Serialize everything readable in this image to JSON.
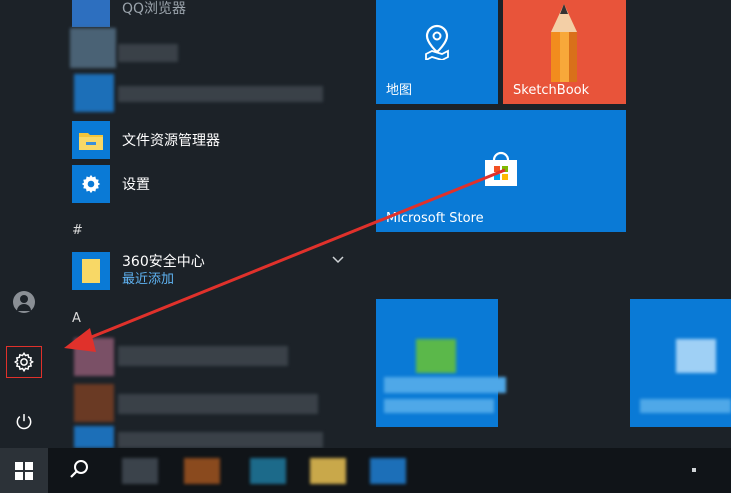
{
  "apps": {
    "top_partial": "QQ浏览器",
    "file_explorer": "文件资源管理器",
    "settings": "设置",
    "section_hash": "#",
    "security_center": "360安全中心",
    "security_center_sub": "最近添加",
    "section_a": "A"
  },
  "tiles": {
    "maps": "地图",
    "sketchbook": "SketchBook",
    "store": "Microsoft Store"
  },
  "colors": {
    "accent": "#0a7ad6",
    "background": "#1c2228",
    "taskbar": "#101418",
    "highlight_box": "#e0312b",
    "arrow": "#e0312b"
  },
  "icons": {
    "rail": [
      "user-icon",
      "gear-icon",
      "power-icon"
    ],
    "taskbar": [
      "windows-icon",
      "search-icon"
    ]
  }
}
